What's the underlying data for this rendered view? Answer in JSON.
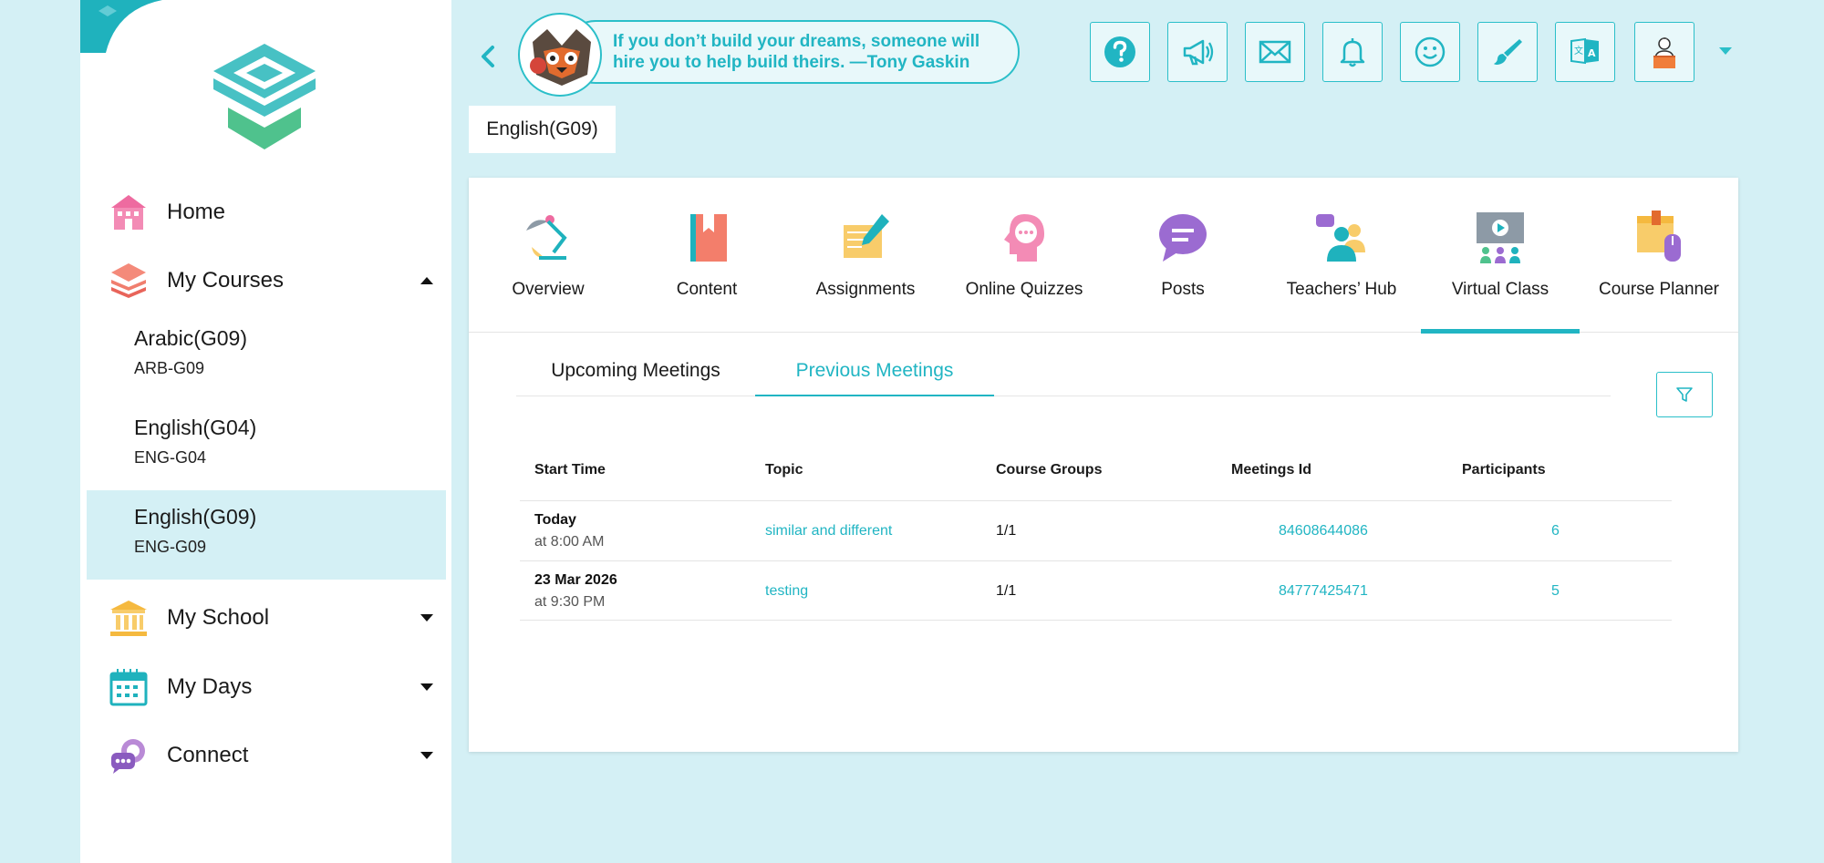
{
  "sidebar": {
    "items": [
      {
        "label": "Home"
      },
      {
        "label": "My Courses"
      },
      {
        "label": "My School"
      },
      {
        "label": "My Days"
      },
      {
        "label": "Connect"
      }
    ],
    "courses": [
      {
        "title": "Arabic(G09)",
        "code": "ARB-G09"
      },
      {
        "title": "English(G04)",
        "code": "ENG-G04"
      },
      {
        "title": "English(G09)",
        "code": "ENG-G09"
      }
    ]
  },
  "header": {
    "quote": "If you don’t build your dreams, someone will hire you to help build theirs. —Tony Gaskin"
  },
  "course_tag": "English(G09)",
  "modules": [
    {
      "label": "Overview"
    },
    {
      "label": "Content"
    },
    {
      "label": "Assignments"
    },
    {
      "label": "Online Quizzes"
    },
    {
      "label": "Posts"
    },
    {
      "label": "Teachers’ Hub"
    },
    {
      "label": "Virtual Class"
    },
    {
      "label": "Course Planner"
    }
  ],
  "meetings": {
    "tabs": [
      {
        "label": "Upcoming Meetings"
      },
      {
        "label": "Previous Meetings"
      }
    ],
    "columns": [
      "Start Time",
      "Topic",
      "Course Groups",
      "Meetings Id",
      "Participants"
    ],
    "rows": [
      {
        "date": "Today",
        "time": "at 8:00 AM",
        "topic": "similar and different",
        "groups": "1/1",
        "id": "84608644086",
        "participants": "6"
      },
      {
        "date": "23 Mar 2026",
        "time": "at 9:30 PM",
        "topic": "testing",
        "groups": "1/1",
        "id": "84777425471",
        "participants": "5"
      }
    ]
  },
  "colors": {
    "accent": "#21b5c3",
    "background": "#d4f0f5",
    "selected": "#d4f0f5"
  }
}
